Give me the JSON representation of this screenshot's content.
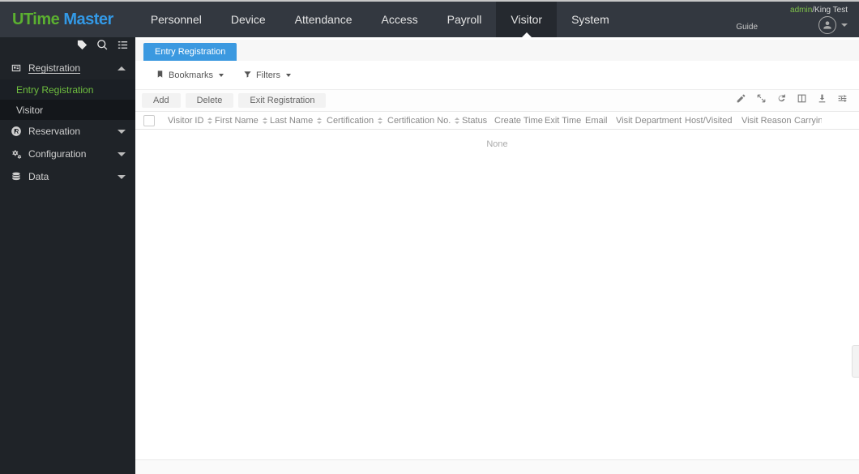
{
  "brand": {
    "part1": "UTime ",
    "part2": "Master"
  },
  "nav": {
    "items": [
      "Personnel",
      "Device",
      "Attendance",
      "Access",
      "Payroll",
      "Visitor",
      "System"
    ],
    "active_index": 5
  },
  "header_right": {
    "guide_label": "Guide",
    "user_admin": "admin",
    "user_separator": "/",
    "user_company": "King Test"
  },
  "sidebar": {
    "sections": [
      {
        "name": "registration",
        "label": "Registration",
        "expanded": true,
        "items": [
          {
            "label": "Entry Registration",
            "active": true
          },
          {
            "label": "Visitor",
            "active": false
          }
        ]
      },
      {
        "name": "reservation",
        "label": "Reservation",
        "expanded": false
      },
      {
        "name": "configuration",
        "label": "Configuration",
        "expanded": false
      },
      {
        "name": "data",
        "label": "Data",
        "expanded": false
      }
    ]
  },
  "tabs": {
    "items": [
      "Entry Registration"
    ]
  },
  "toolbar": {
    "bookmarks_label": "Bookmarks",
    "filters_label": "Filters"
  },
  "actions": {
    "add": "Add",
    "delete": "Delete",
    "exit_registration": "Exit Registration"
  },
  "table": {
    "columns": [
      "Visitor ID",
      "First Name",
      "Last Name",
      "Certification",
      "Certification No.",
      "Status",
      "Create Time",
      "Exit Time",
      "Email",
      "Visit Department",
      "Host/Visited",
      "Visit Reason",
      "Carryin"
    ],
    "sortable_indices": [
      0,
      1,
      2,
      3,
      4
    ],
    "empty_text": "None"
  }
}
